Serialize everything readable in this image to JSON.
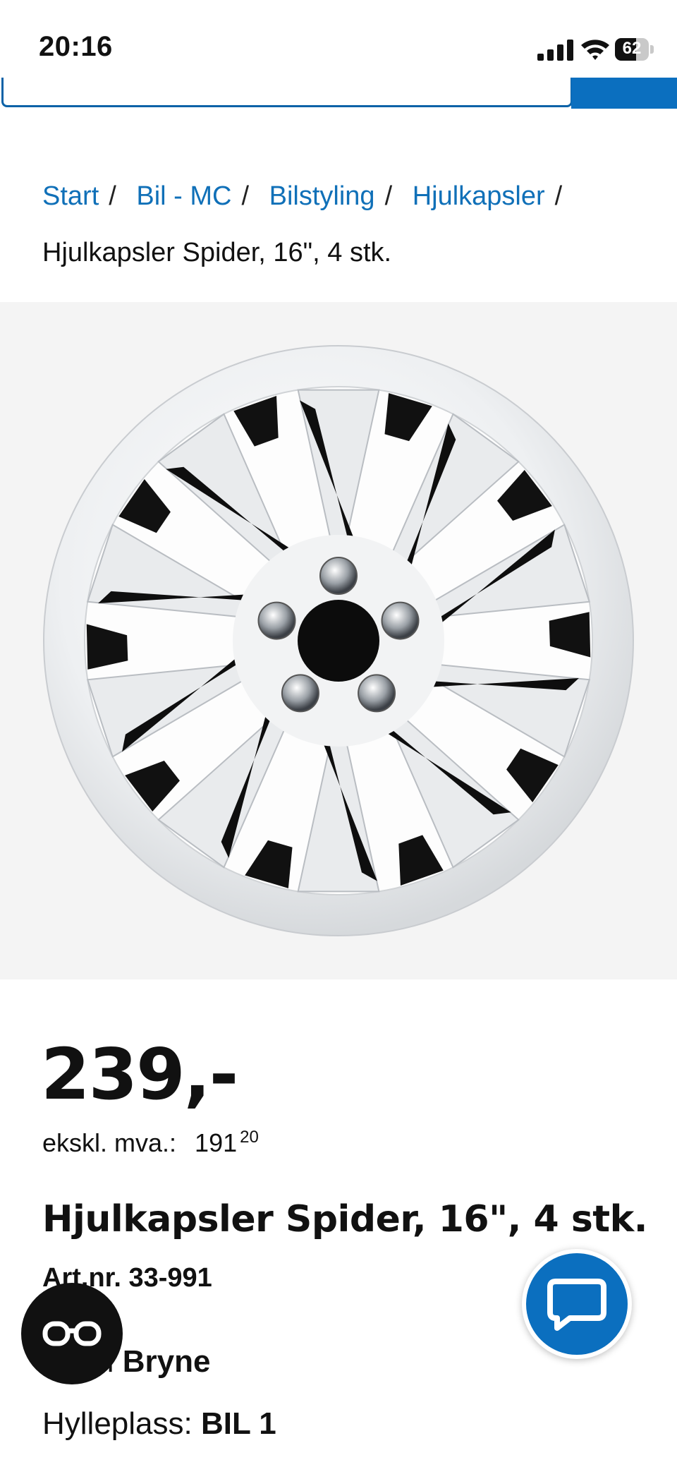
{
  "status": {
    "time": "20:16",
    "battery": "62",
    "battery_level": 0.62
  },
  "breadcrumb": {
    "items": [
      "Start",
      "Bil - MC",
      "Bilstyling",
      "Hjulkapsler"
    ],
    "separator": "/",
    "current": "Hjulkapsler Spider, 16\", 4 stk."
  },
  "product": {
    "price": "239,-",
    "ex_vat_label": "ekskl. mva.:",
    "ex_vat_value": "191",
    "ex_vat_cents": "20",
    "title": "Hjulkapsler Spider, 16\", 4 stk.",
    "art_nr": "Art.nr. 33-991",
    "stock_prefix": "+) i ",
    "stock_store": "Bryne",
    "shelf_label": "Hylleplass: ",
    "shelf_value": "BIL 1"
  },
  "colors": {
    "brand_blue": "#0b6fbf",
    "link_blue": "#1070b8"
  },
  "icons": {
    "chat": "chat-bubble-icon",
    "glasses": "reading-glasses-icon"
  }
}
